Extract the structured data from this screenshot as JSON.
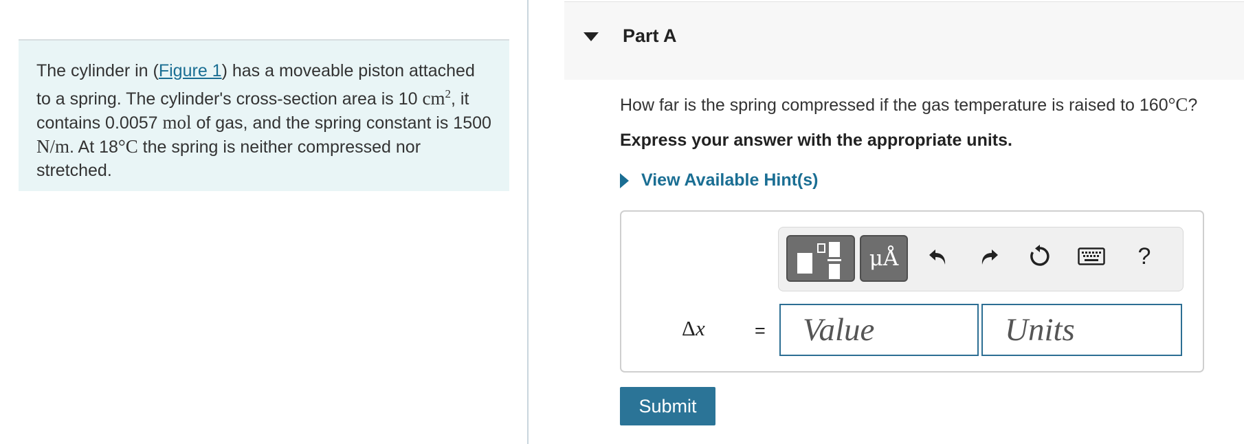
{
  "problem": {
    "text_1": "The cylinder in (",
    "figure_link": "Figure 1",
    "text_2": ") has a moveable piston attached to a spring. The cylinder's cross-section area is 10 ",
    "area_unit": "cm",
    "area_exp": "2",
    "text_3": ", it contains 0.0057 ",
    "mol_unit": "mol",
    "text_4": " of gas, and the spring constant is 1500 ",
    "spring_unit": "N/m",
    "text_5": ". At 18",
    "temp_unit_1": "°C",
    "text_6": " the spring is neither compressed nor stretched."
  },
  "part": {
    "title": "Part A",
    "question_text": "How far is the spring compressed if the gas temperature is raised to 160",
    "question_unit": "°C",
    "question_end": "?",
    "instruction": "Express your answer with the appropriate units.",
    "hint_label": "View Available Hint(s)"
  },
  "answer": {
    "variable_symbol": "Δ",
    "variable_letter": "x",
    "equals": "=",
    "value_placeholder": "Value",
    "units_placeholder": "Units",
    "symbols_button_label": "μÅ",
    "help_label": "?"
  },
  "submit_label": "Submit",
  "colors": {
    "panel_bg": "#e9f5f6",
    "link": "#1a6e93",
    "submit_bg": "#2b7497",
    "input_border": "#2c6e93"
  },
  "icons": [
    "templates-icon",
    "symbols-icon",
    "undo-icon",
    "redo-icon",
    "reset-icon",
    "keyboard-icon",
    "help-icon",
    "caret-down-icon",
    "caret-right-icon"
  ]
}
